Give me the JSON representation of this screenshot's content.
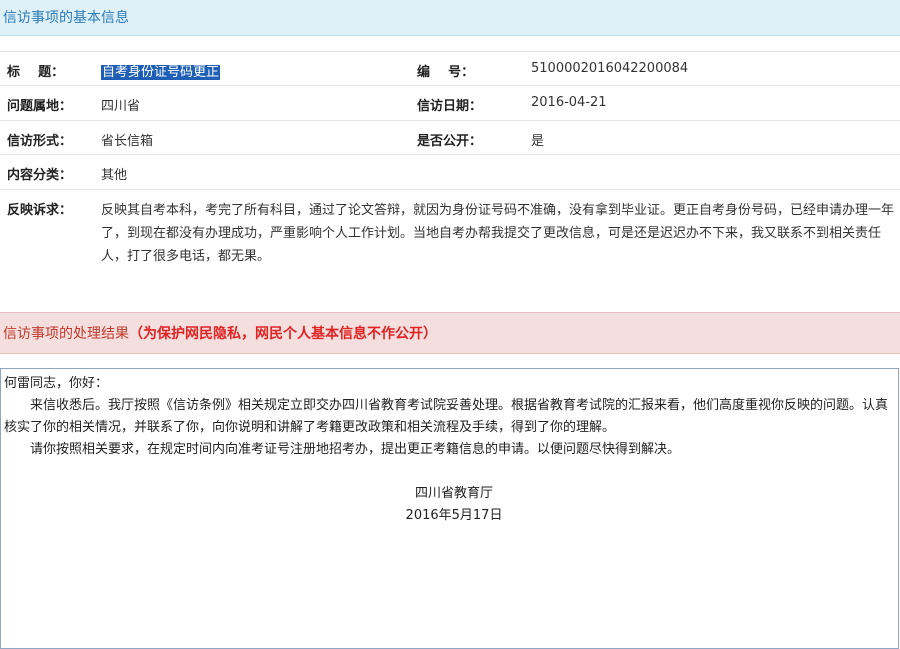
{
  "basic_info": {
    "header": "信访事项的基本信息",
    "rows": [
      {
        "label1": "标    题：",
        "value1": "自考身份证号码更正",
        "label2": "编    号：",
        "value2": "5100002016042200084"
      },
      {
        "label1": "问题属地：",
        "value1": "四川省",
        "label2": "信访日期：",
        "value2": "2016-04-21"
      },
      {
        "label1": "信访形式：",
        "value1": "省长信箱",
        "label2": "是否公开：",
        "value2": "是"
      },
      {
        "label1": "内容分类：",
        "value1": "其他"
      }
    ],
    "content_label": "反映诉求：",
    "content_text": "反映其自考本科，考完了所有科目，通过了论文答辩，就因为身份证号码不准确，没有拿到毕业证。更正自考身份号码，已经申请办理一年了，到现在都没有办理成功，严重影响个人工作计划。当地自考办帮我提交了更改信息，可是还是迟迟办不下来，我又联系不到相关责任人，打了很多电话，都无果。"
  },
  "result": {
    "header": "信访事项的处理结果",
    "header_note": "（为保护网民隐私，网民个人基本信息不作公开）",
    "greeting": "何雷同志，你好：",
    "para1": "来信收悉后。我厅按照《信访条例》相关规定立即交办四川省教育考试院妥善处理。根据省教育考试院的汇报来看，他们高度重视你反映的问题。认真核实了你的相关情况，并联系了你，向你说明和讲解了考籍更改政策和相关流程及手续，得到了你的理解。",
    "para2": "请你按照相关要求，在规定时间内向准考证号注册地招考办，提出更正考籍信息的申请。以便问题尽快得到解决。",
    "signature": "四川省教育厅",
    "date": "2016年5月17日"
  },
  "colors": {
    "blue_header_bg": "#dff0f8",
    "blue_header_text": "#2b7db8",
    "red_header_bg": "#f5dede",
    "red_header_text": "#c0392b",
    "red_note_text": "#e02424",
    "selection": "#1e5fb5"
  }
}
